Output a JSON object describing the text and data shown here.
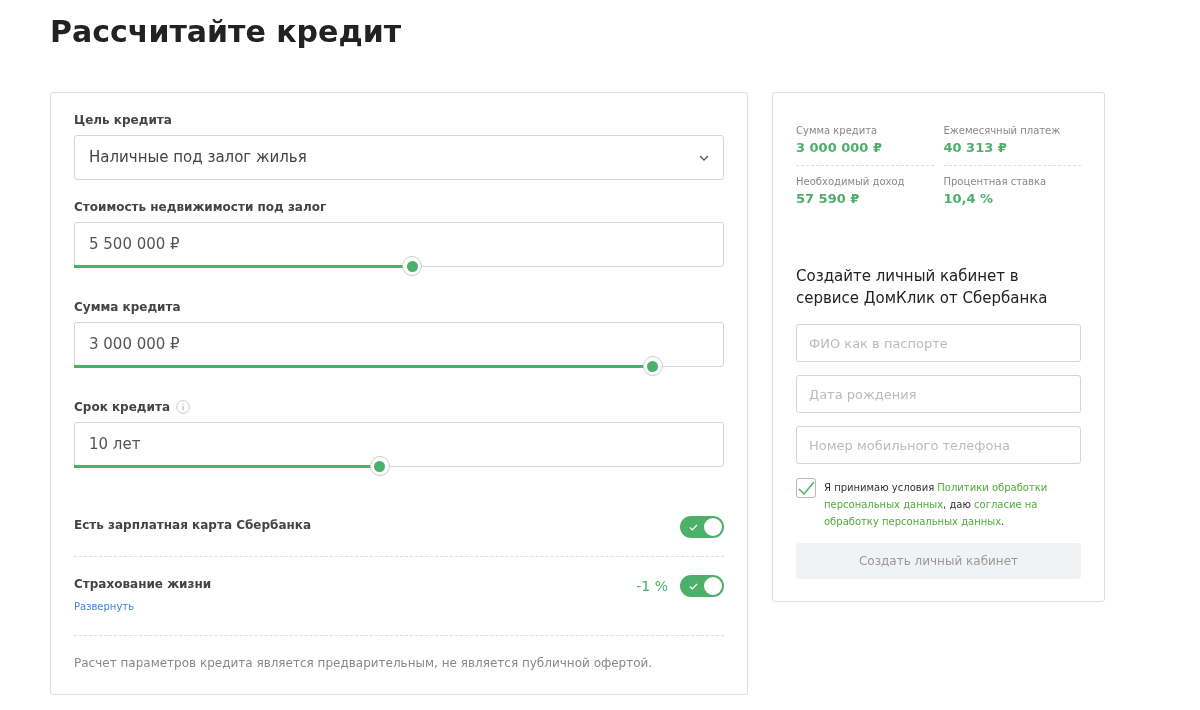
{
  "title": "Рассчитайте кредит",
  "calculator": {
    "purpose": {
      "label": "Цель кредита",
      "value": "Наличные под залог жилья"
    },
    "sliders": [
      {
        "label": "Стоимость недвижимости под залог",
        "value": "5 500 000 ₽",
        "level": 0.52,
        "info": false
      },
      {
        "label": "Сумма кредита",
        "value": "3 000 000 ₽",
        "level": 0.89,
        "info": false
      },
      {
        "label": "Срок кредита",
        "value": "10 лет",
        "level": 0.47,
        "info": true
      }
    ],
    "toggles": [
      {
        "label": "Есть зарплатная карта Сбербанка",
        "on": true
      },
      {
        "label": "Страхование жизни",
        "on": true,
        "discount": "-1 %",
        "link": "Развернуть"
      }
    ],
    "disclaimer": "Расчет параметров кредита является предварительным, не является публичной офертой."
  },
  "summary": {
    "stats": [
      {
        "label": "Сумма кредита",
        "value": "3 000 000 ₽"
      },
      {
        "label": "Ежемесячный платеж",
        "value": "40 313 ₽"
      },
      {
        "label": "Необходимый доход",
        "value": "57 590 ₽"
      },
      {
        "label": "Процентная ставка",
        "value": "10,4 %"
      }
    ],
    "heading": "Создайте личный кабинет в сервисе ДомКлик от Сбербанка",
    "fields": [
      {
        "placeholder": "ФИО как в паспорте"
      },
      {
        "placeholder": "Дата рождения"
      },
      {
        "placeholder": "Номер мобильного телефона"
      }
    ],
    "consent": {
      "checked": true,
      "parts": [
        {
          "kind": "text",
          "text": "Я принимаю условия "
        },
        {
          "kind": "link",
          "text": "Политики обработки персональных данных"
        },
        {
          "kind": "text",
          "text": ", даю "
        },
        {
          "kind": "link",
          "text": "согласие на обработку персональных данных"
        },
        {
          "kind": "text",
          "text": "."
        }
      ]
    },
    "button": {
      "label": "Создать личный кабинет",
      "disabled": true
    }
  }
}
